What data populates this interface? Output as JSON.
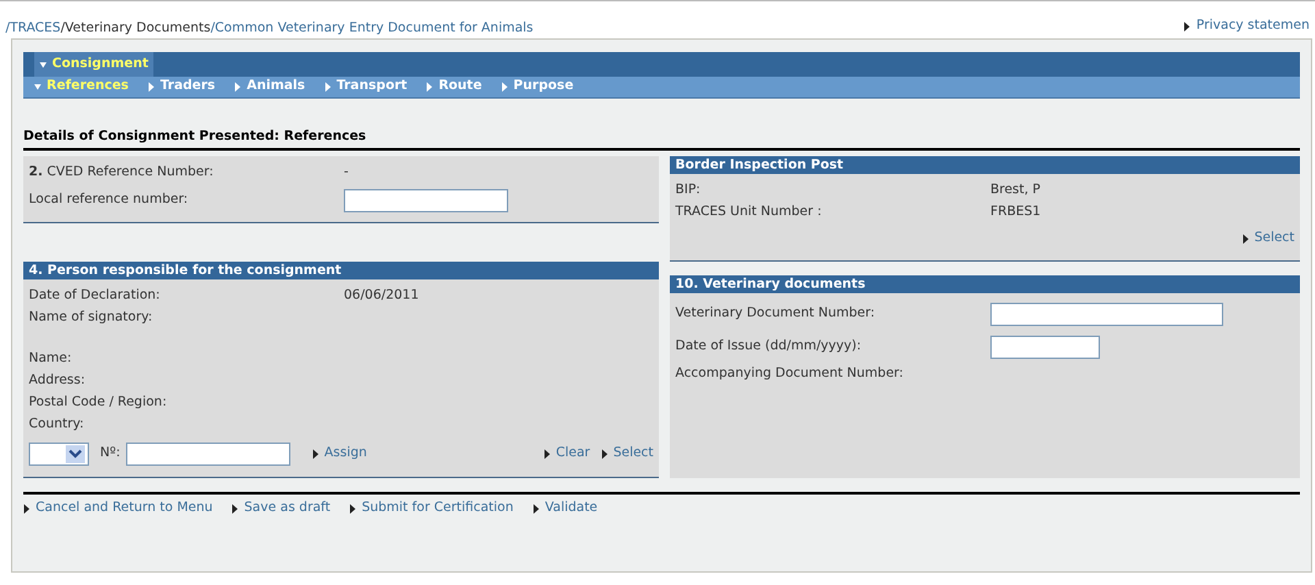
{
  "breadcrumb": [
    {
      "text": "/TRACES",
      "kind": "link"
    },
    {
      "text": "/Veterinary Documents",
      "kind": "text"
    },
    {
      "text": "/Common Veterinary Entry Document for Animals",
      "kind": "link"
    }
  ],
  "privacy_link": "Privacy statemen",
  "tabs": [
    {
      "label": "Consignment",
      "selected": true
    }
  ],
  "subtabs": [
    {
      "label": "References",
      "selected": true
    },
    {
      "label": "Traders",
      "selected": false
    },
    {
      "label": "Animals",
      "selected": false
    },
    {
      "label": "Transport",
      "selected": false
    },
    {
      "label": "Route",
      "selected": false
    },
    {
      "label": "Purpose",
      "selected": false
    }
  ],
  "page_title": "Details of Consignment Presented: References",
  "left_sections": [
    {
      "rows": [
        {
          "kind": "value",
          "label": "**2.** CVED Reference Number:",
          "value": "-"
        },
        {
          "kind": "field-medium",
          "label": "Local reference number:"
        }
      ]
    },
    {
      "title": "4. Person responsible for the consignment",
      "rows": [
        {
          "kind": "value",
          "label": "Date of Declaration:",
          "value": "06/06/2011"
        },
        {
          "kind": "value",
          "label": "Name of signatory:"
        },
        {
          "kind": "blank"
        },
        {
          "kind": "value",
          "label": "Name:"
        },
        {
          "kind": "value",
          "label": "Address:"
        },
        {
          "kind": "value",
          "label": "Postal Code / Region:"
        },
        {
          "kind": "value",
          "label": "Country:"
        }
      ],
      "controls": {
        "number_label": "Nº:",
        "assign": "Assign",
        "links": [
          "Clear",
          "Select"
        ]
      }
    }
  ],
  "right_sections": [
    {
      "title": "Border Inspection Post",
      "rows": [
        {
          "kind": "value",
          "label": "BIP:",
          "value": "Brest, P"
        },
        {
          "kind": "value",
          "label": "TRACES Unit Number :",
          "value": "FRBES1"
        }
      ],
      "links": [
        "Select"
      ]
    },
    {
      "title": "10. Veterinary documents",
      "rows": [
        {
          "kind": "field-wide",
          "label": "Veterinary Document Number:"
        },
        {
          "kind": "field-narrow",
          "label": "Date of Issue (dd/mm/yyyy):"
        },
        {
          "kind": "value",
          "label": "Accompanying Document Number:"
        }
      ]
    }
  ],
  "actions": [
    "Cancel and Return to Menu",
    "Save as draft",
    "Submit for Certification",
    "Validate"
  ]
}
